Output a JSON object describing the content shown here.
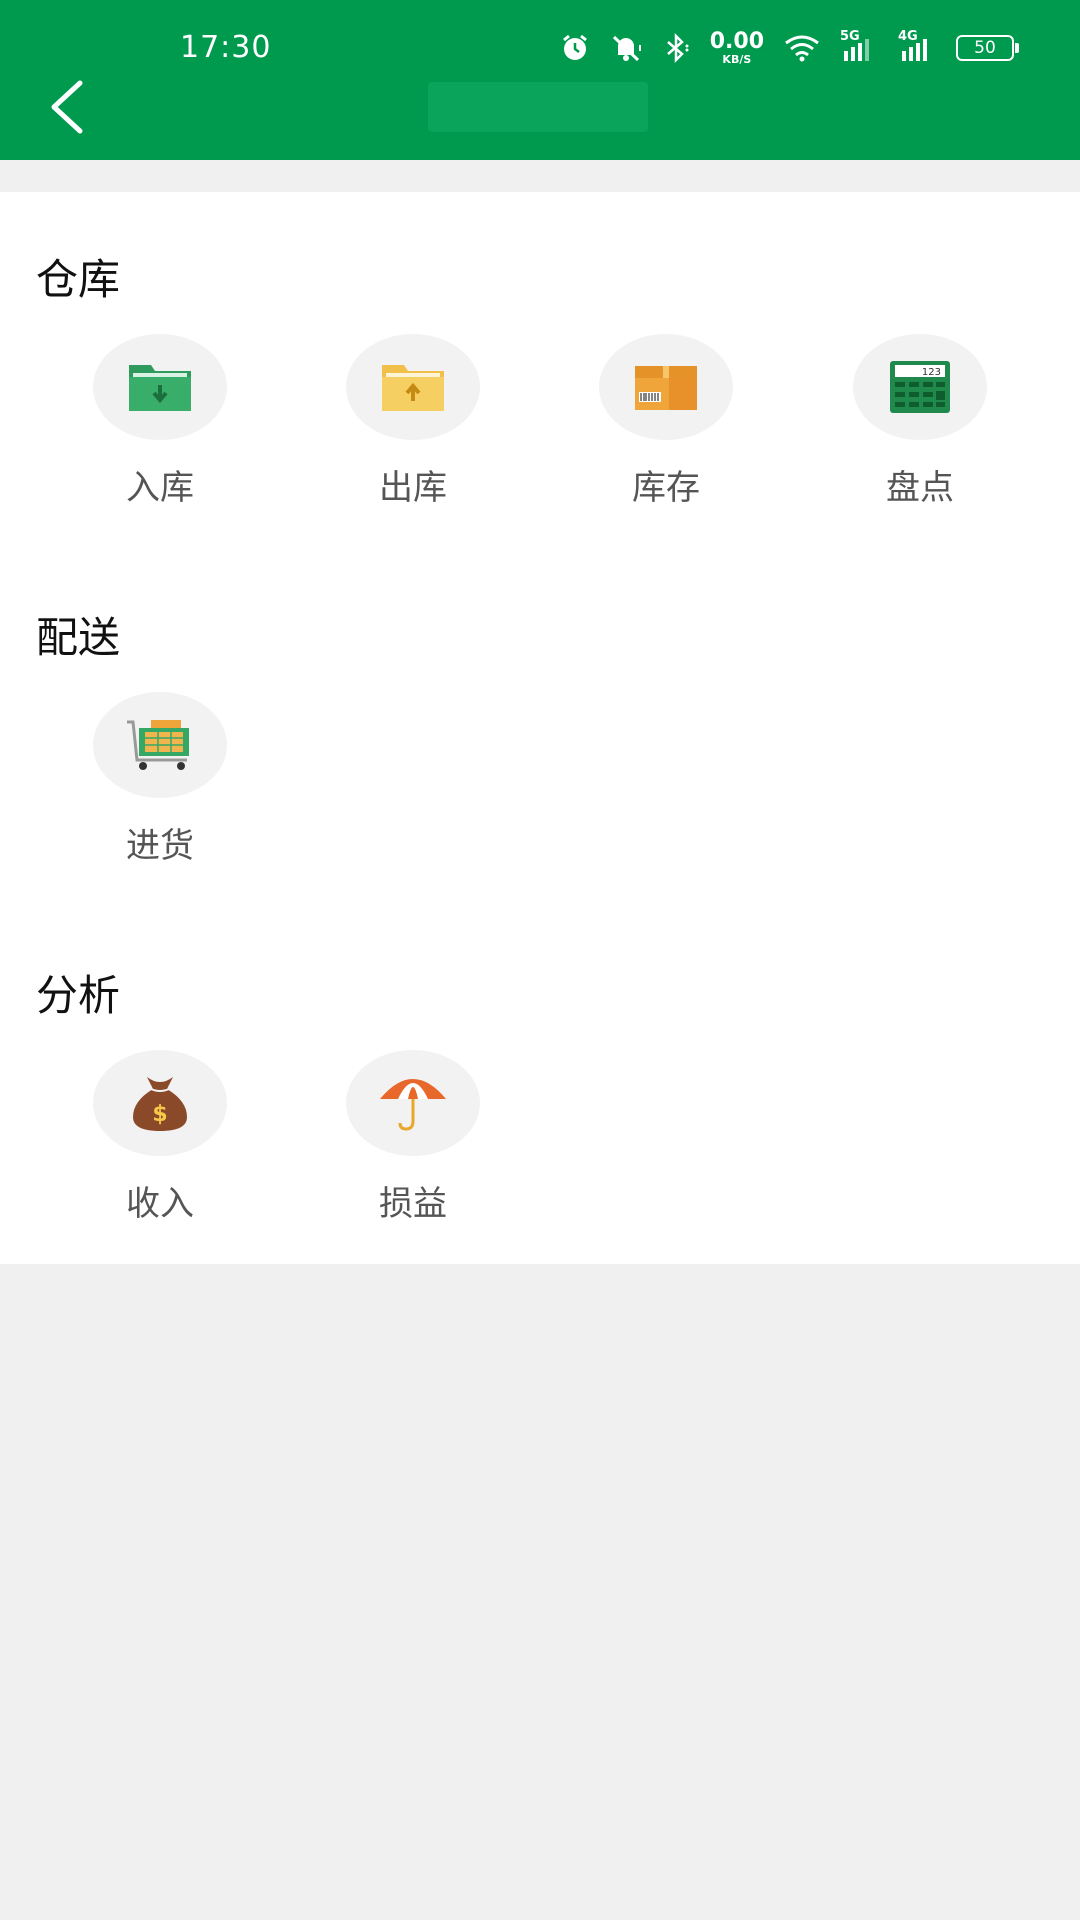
{
  "status_bar": {
    "time": "17:30",
    "net_speed_value": "0.00",
    "net_speed_unit": "KB/S",
    "network_5g": "5G",
    "network_4g": "4G",
    "battery": "50",
    "icons": [
      "alarm-icon",
      "mute-icon",
      "bluetooth-icon",
      "wifi-icon",
      "signal-icon",
      "battery-icon"
    ]
  },
  "header": {
    "back_icon": "chevron-left-icon",
    "accent_color": "#009a4f"
  },
  "sections": [
    {
      "title": "仓库",
      "items": [
        {
          "label": "入库",
          "icon": "folder-in-icon"
        },
        {
          "label": "出库",
          "icon": "folder-out-icon"
        },
        {
          "label": "库存",
          "icon": "box-icon"
        },
        {
          "label": "盘点",
          "icon": "calculator-icon"
        }
      ]
    },
    {
      "title": "配送",
      "items": [
        {
          "label": "进货",
          "icon": "cart-icon"
        }
      ]
    },
    {
      "title": "分析",
      "items": [
        {
          "label": "收入",
          "icon": "money-bag-icon"
        },
        {
          "label": "损益",
          "icon": "umbrella-icon"
        }
      ]
    }
  ]
}
